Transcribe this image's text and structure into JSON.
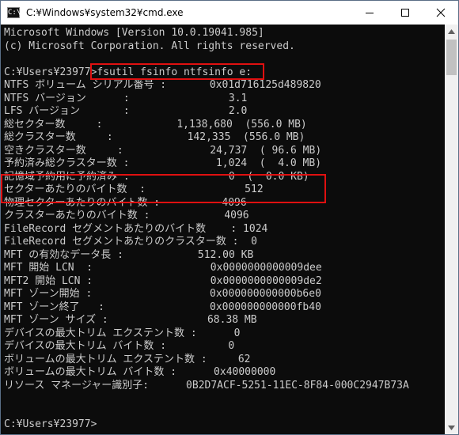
{
  "window": {
    "title": "C:¥Windows¥system32¥cmd.exe",
    "icon_text": "C:\\",
    "icons": {
      "minimize": "minimize-icon",
      "maximize": "maximize-icon",
      "close": "close-icon"
    }
  },
  "console": {
    "lines": [
      "Microsoft Windows [Version 10.0.19041.985]",
      "(c) Microsoft Corporation. All rights reserved.",
      "",
      "C:¥Users¥23977>fsutil fsinfo ntfsinfo e:",
      "NTFS ボリューム シリアル番号 :       0x01d716125d489820",
      "NTFS バージョン      :                3.1",
      "LFS バージョン       :                2.0",
      "総セクター数     :            1,138,680  (556.0 MB)",
      "総クラスター数     :            142,335  (556.0 MB)",
      "空きクラスター数     :              24,737  ( 96.6 MB)",
      "予約済み総クラスター数 :              1,024  (  4.0 MB)",
      "記憶域予約用に予約済み :                0  (  0.0 KB)",
      "セクターあたりのバイト数  :                512",
      "物理セクターあたりのバイト数 :          4096",
      "クラスターあたりのバイト数 :            4096",
      "FileRecord セグメントあたりのバイト数    : 1024",
      "FileRecord セグメントあたりのクラスター数 :  0",
      "MFT の有効なデータ長 :            512.00 KB",
      "MFT 開始 LCN  :                   0x0000000000009dee",
      "MFT2 開始 LCN :                   0x0000000000009de2",
      "MFT ゾーン開始 :                   0x000000000000b6e0",
      "MFT ゾーン終了   :                 0x000000000000fb40",
      "MFT ゾーン サイズ :                68.38 MB",
      "デバイスの最大トリム エクステント数 :      0",
      "デバイスの最大トリム バイト数 :          0",
      "ボリュームの最大トリム エクステント数 :     62",
      "ボリュームの最大トリム バイト数 :      0x40000000",
      "リソース マネージャー識別子:      0B2D7ACF-5251-11EC-8F84-000C2947B73A",
      "",
      "",
      "C:¥Users¥23977>"
    ]
  },
  "colors": {
    "console_bg": "#0c0c0c",
    "console_fg": "#cccccc",
    "highlight": "#e01010",
    "titlebar_bg": "#ffffff"
  }
}
